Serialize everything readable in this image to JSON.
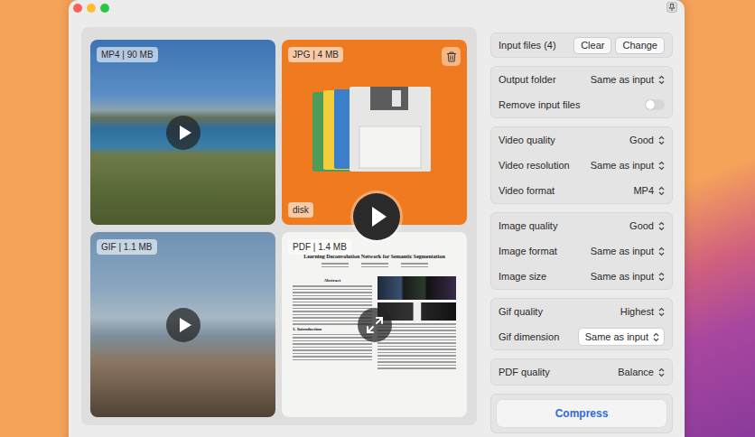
{
  "window": {
    "controls": [
      {
        "color": "#ff5f57"
      },
      {
        "color": "#febc2e"
      },
      {
        "color": "#28c840"
      }
    ]
  },
  "media": [
    {
      "badge": "MP4 | 90 MB",
      "kind": "video",
      "hovered": false
    },
    {
      "badge": "JPG | 4 MB",
      "kind": "image",
      "hovered": true,
      "caption": "disk"
    },
    {
      "badge": "GIF | 1.1 MB",
      "kind": "gif",
      "hovered": false
    },
    {
      "badge": "PDF | 1.4 MB",
      "kind": "pdf",
      "hovered": false,
      "document": {
        "title": "Learning Deconvolution Network for Semantic Segmentation",
        "headings": [
          "Abstract",
          "1. Introduction"
        ]
      }
    }
  ],
  "settings": {
    "input": {
      "label": "Input files (4)",
      "buttons": [
        {
          "label": "Clear"
        },
        {
          "label": "Change"
        }
      ]
    },
    "groups": [
      {
        "rows": [
          {
            "kind": "select",
            "label": "Output folder",
            "value": "Same as input"
          },
          {
            "kind": "toggle",
            "label": "Remove input files",
            "on": false
          }
        ]
      },
      {
        "rows": [
          {
            "kind": "select",
            "label": "Video quality",
            "value": "Good"
          },
          {
            "kind": "select",
            "label": "Video resolution",
            "value": "Same as input"
          },
          {
            "kind": "select",
            "label": "Video format",
            "value": "MP4"
          }
        ]
      },
      {
        "rows": [
          {
            "kind": "select",
            "label": "Image quality",
            "value": "Good"
          },
          {
            "kind": "select",
            "label": "Image format",
            "value": "Same as input"
          },
          {
            "kind": "select",
            "label": "Image size",
            "value": "Same as input"
          }
        ]
      },
      {
        "rows": [
          {
            "kind": "select",
            "label": "Gif quality",
            "value": "Highest"
          },
          {
            "kind": "popup",
            "label": "Gif dimension",
            "value": "Same as input"
          }
        ]
      },
      {
        "rows": [
          {
            "kind": "select",
            "label": "PDF quality",
            "value": "Balance"
          }
        ]
      }
    ],
    "action": {
      "label": "Compress"
    }
  }
}
